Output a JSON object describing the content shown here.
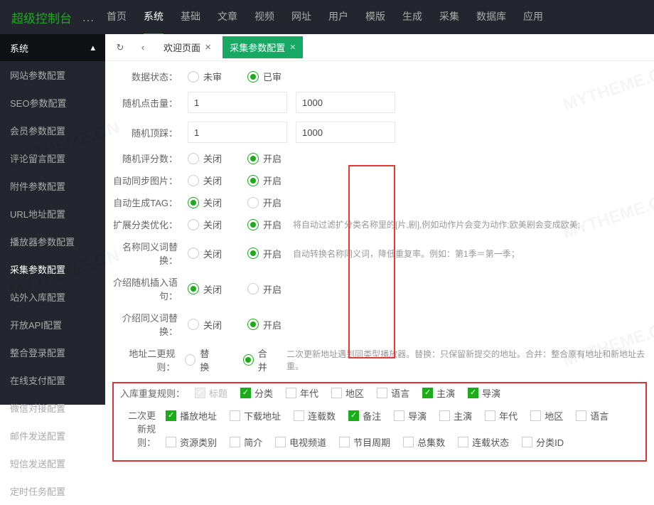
{
  "header": {
    "logo": "超级控制台",
    "dots": "…"
  },
  "topnav": [
    "首页",
    "系统",
    "基础",
    "文章",
    "视频",
    "网址",
    "用户",
    "模版",
    "生成",
    "采集",
    "数据库",
    "应用"
  ],
  "topnav_active": 1,
  "side_head": {
    "title": "系统",
    "chevron": "▴"
  },
  "sidebar": [
    "网站参数配置",
    "SEO参数配置",
    "会员参数配置",
    "评论留言配置",
    "附件参数配置",
    "URL地址配置",
    "播放器参数配置",
    "采集参数配置",
    "站外入库配置",
    "开放API配置",
    "整合登录配置",
    "在线支付配置",
    "微信对接配置",
    "邮件发送配置",
    "短信发送配置",
    "定时任务配置"
  ],
  "sidebar_active": 7,
  "tabbar": {
    "refresh": "↻",
    "back": "‹",
    "tab1": "欢迎页面",
    "tab2": "采集参数配置"
  },
  "form": {
    "data_status": {
      "label": "数据状态：",
      "opt1": "未审",
      "opt2": "已审",
      "sel": 2
    },
    "rand_click": {
      "label": "随机点击量：",
      "v1": "1",
      "v2": "1000"
    },
    "rand_top": {
      "label": "随机顶踩：",
      "v1": "1",
      "v2": "1000"
    },
    "rand_score": {
      "label": "随机评分数：",
      "opt1": "关闭",
      "opt2": "开启",
      "sel": 2
    },
    "auto_img": {
      "label": "自动同步图片：",
      "opt1": "关闭",
      "opt2": "开启",
      "sel": 2
    },
    "auto_tag": {
      "label": "自动生成TAG：",
      "opt1": "关闭",
      "opt2": "开启",
      "sel": 1
    },
    "ext_cat": {
      "label": "扩展分类优化：",
      "opt1": "关闭",
      "opt2": "开启",
      "sel": 2,
      "hint": "将自动过滤扩分类名称里的[片,剧],例如动作片会变为动作;欧美剧会变成欧美;"
    },
    "syn_name": {
      "label": "名称同义词替换：",
      "opt1": "关闭",
      "opt2": "开启",
      "sel": 2,
      "hint": "自动转换名称同义词，降低重复率。例如：第1季＝第一季；"
    },
    "intro_rand": {
      "label": "介绍随机插入语句：",
      "opt1": "关闭",
      "opt2": "开启",
      "sel": 1
    },
    "intro_syn": {
      "label": "介绍同义词替换：",
      "opt1": "关闭",
      "opt2": "开启",
      "sel": 2
    },
    "addr_rule": {
      "label": "地址二更规则：",
      "opt1": "替换",
      "opt2": "合并",
      "sel": 2,
      "hint": "二次更新地址遇到同类型播放器。替换：只保留新提交的地址。合并：整合原有地址和新地址去重。"
    },
    "dup_rule": {
      "label": "入库重复规则：",
      "items": [
        {
          "t": "标题",
          "c": true,
          "d": true
        },
        {
          "t": "分类",
          "c": true
        },
        {
          "t": "年代",
          "c": false
        },
        {
          "t": "地区",
          "c": false
        },
        {
          "t": "语言",
          "c": false
        },
        {
          "t": "主演",
          "c": true
        },
        {
          "t": "导演",
          "c": true
        }
      ]
    },
    "update_rule": {
      "label": "二次更新规则：",
      "items": [
        {
          "t": "播放地址",
          "c": true
        },
        {
          "t": "下载地址",
          "c": false
        },
        {
          "t": "连载数",
          "c": false
        },
        {
          "t": "备注",
          "c": true
        },
        {
          "t": "导演",
          "c": false
        },
        {
          "t": "主演",
          "c": false
        },
        {
          "t": "年代",
          "c": false
        },
        {
          "t": "地区",
          "c": false
        },
        {
          "t": "语言",
          "c": false
        },
        {
          "t": "资源类别",
          "c": false
        },
        {
          "t": "简介",
          "c": false
        },
        {
          "t": "电视频道",
          "c": false
        },
        {
          "t": "节目周期",
          "c": false
        },
        {
          "t": "总集数",
          "c": false
        },
        {
          "t": "连载状态",
          "c": false
        },
        {
          "t": "分类ID",
          "c": false
        }
      ]
    }
  },
  "watermark": "MYTHEME.CN"
}
